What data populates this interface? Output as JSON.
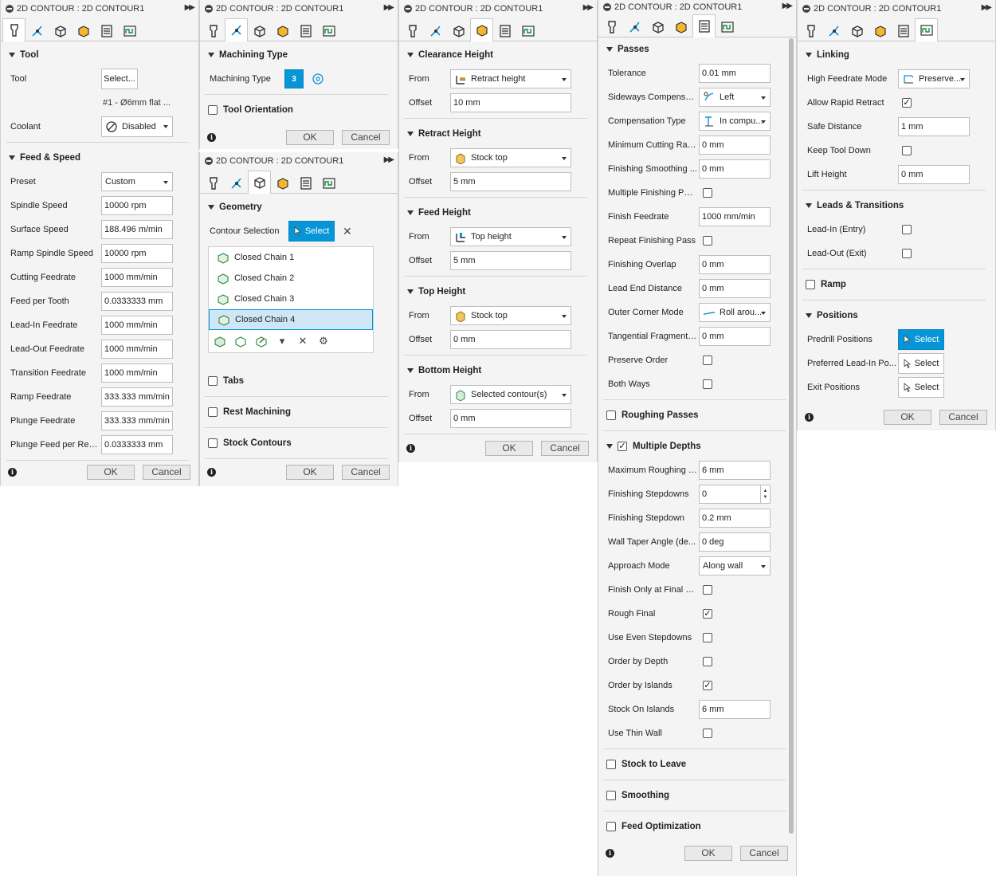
{
  "window_title": "2D CONTOUR : 2D CONTOUR1",
  "ok_label": "OK",
  "cancel_label": "Cancel",
  "tab_icons": [
    "tool-tab-icon",
    "geometry-tab-icon",
    "heights-tab-icon",
    "passes-tab-icon",
    "linking-tab-icon",
    "positions-tab-icon"
  ],
  "panel1": {
    "tool_section": "Tool",
    "tool_label": "Tool",
    "tool_select": "Select...",
    "tool_desc": "#1 - Ø6mm flat ...",
    "coolant_label": "Coolant",
    "coolant_value": "Disabled",
    "feed_section": "Feed & Speed",
    "rows": [
      {
        "label": "Preset",
        "value": "Custom",
        "type": "dropdown"
      },
      {
        "label": "Spindle Speed",
        "value": "10000 rpm"
      },
      {
        "label": "Surface Speed",
        "value": "188.496 m/min"
      },
      {
        "label": "Ramp Spindle Speed",
        "value": "10000 rpm"
      },
      {
        "label": "Cutting Feedrate",
        "value": "1000 mm/min"
      },
      {
        "label": "Feed per Tooth",
        "value": "0.0333333 mm"
      },
      {
        "label": "Lead-In Feedrate",
        "value": "1000 mm/min"
      },
      {
        "label": "Lead-Out Feedrate",
        "value": "1000 mm/min"
      },
      {
        "label": "Transition Feedrate",
        "value": "1000 mm/min"
      },
      {
        "label": "Ramp Feedrate",
        "value": "333.333 mm/min"
      },
      {
        "label": "Plunge Feedrate",
        "value": "333.333 mm/min"
      },
      {
        "label": "Plunge Feed per Rev...",
        "value": "0.0333333 mm"
      }
    ]
  },
  "panel2a": {
    "machining_section": "Machining Type",
    "machining_label": "Machining Type",
    "machining_badge": "3",
    "tool_orientation": "Tool Orientation"
  },
  "panel2b": {
    "geometry_section": "Geometry",
    "contour_label": "Contour Selection",
    "select_label": "Select",
    "chains": [
      "Closed Chain 1",
      "Closed Chain 2",
      "Closed Chain 3",
      "Closed Chain 4"
    ],
    "tabs_section": "Tabs",
    "rest_section": "Rest Machining",
    "stock_section": "Stock Contours"
  },
  "panel3": {
    "sections": [
      {
        "title": "Clearance Height",
        "from": "Retract height",
        "offset": "10 mm"
      },
      {
        "title": "Retract Height",
        "from": "Stock top",
        "offset": "5 mm"
      },
      {
        "title": "Feed Height",
        "from": "Top height",
        "offset": "5 mm"
      },
      {
        "title": "Top Height",
        "from": "Stock top",
        "offset": "0 mm"
      },
      {
        "title": "Bottom Height",
        "from": "Selected contour(s)",
        "offset": "0 mm"
      }
    ],
    "from_label": "From",
    "offset_label": "Offset"
  },
  "panel4": {
    "passes_section": "Passes",
    "rows": [
      {
        "label": "Tolerance",
        "value": "0.01 mm",
        "type": "input"
      },
      {
        "label": "Sideways Compensa...",
        "value": "Left",
        "type": "dropdown"
      },
      {
        "label": "Compensation Type",
        "value": "In compu...",
        "type": "dropdown"
      },
      {
        "label": "Minimum Cutting Rad...",
        "value": "0 mm",
        "type": "input"
      },
      {
        "label": "Finishing Smoothing ...",
        "value": "0 mm",
        "type": "input"
      },
      {
        "label": "Multiple Finishing Pas...",
        "checked": false,
        "type": "check"
      },
      {
        "label": "Finish Feedrate",
        "value": "1000 mm/min",
        "type": "input"
      },
      {
        "label": "Repeat Finishing Pass",
        "checked": false,
        "type": "check"
      },
      {
        "label": "Finishing Overlap",
        "value": "0 mm",
        "type": "input"
      },
      {
        "label": "Lead End Distance",
        "value": "0 mm",
        "type": "input"
      },
      {
        "label": "Outer Corner Mode",
        "value": "Roll arou...",
        "type": "dropdown"
      },
      {
        "label": "Tangential Fragment ...",
        "value": "0 mm",
        "type": "input"
      },
      {
        "label": "Preserve Order",
        "checked": false,
        "type": "check"
      },
      {
        "label": "Both Ways",
        "checked": false,
        "type": "check"
      }
    ],
    "roughing_section": "Roughing Passes",
    "depths_section": "Multiple Depths",
    "depth_rows": [
      {
        "label": "Maximum Roughing S...",
        "value": "6 mm",
        "type": "input"
      },
      {
        "label": "Finishing Stepdowns",
        "value": "0",
        "type": "spinner"
      },
      {
        "label": "Finishing Stepdown",
        "value": "0.2 mm",
        "type": "input"
      },
      {
        "label": "Wall Taper Angle (de...",
        "value": "0 deg",
        "type": "input"
      },
      {
        "label": "Approach Mode",
        "value": "Along wall",
        "type": "dropdown"
      },
      {
        "label": "Finish Only at Final D...",
        "checked": false,
        "type": "check"
      },
      {
        "label": "Rough Final",
        "checked": true,
        "type": "check"
      },
      {
        "label": "Use Even Stepdowns",
        "checked": false,
        "type": "check"
      },
      {
        "label": "Order by Depth",
        "checked": false,
        "type": "check"
      },
      {
        "label": "Order by Islands",
        "checked": true,
        "type": "check"
      },
      {
        "label": "Stock On Islands",
        "value": "6 mm",
        "type": "input"
      },
      {
        "label": "Use Thin Wall",
        "checked": false,
        "type": "check"
      }
    ],
    "stock_leave_section": "Stock to Leave",
    "smoothing_section": "Smoothing",
    "feed_opt_section": "Feed Optimization"
  },
  "panel5": {
    "linking_section": "Linking",
    "high_feed_label": "High Feedrate Mode",
    "high_feed_value": "Preserve...",
    "allow_rapid_label": "Allow Rapid Retract",
    "safe_distance_label": "Safe Distance",
    "safe_distance_value": "1 mm",
    "keep_tool_label": "Keep Tool Down",
    "lift_height_label": "Lift Height",
    "lift_height_value": "0 mm",
    "leads_section": "Leads & Transitions",
    "lead_in_label": "Lead-In (Entry)",
    "lead_out_label": "Lead-Out (Exit)",
    "ramp_section": "Ramp",
    "positions_section": "Positions",
    "predrill_label": "Predrill Positions",
    "preferred_label": "Preferred Lead-In Po...",
    "exit_label": "Exit Positions",
    "select_label": "Select"
  }
}
